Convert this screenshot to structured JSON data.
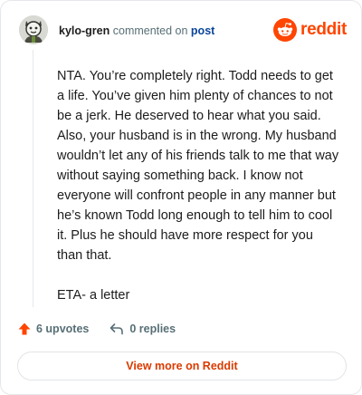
{
  "comment_header": {
    "username": "kylo-gren",
    "action_text": "commented on",
    "post_link": "post"
  },
  "brand": {
    "wordmark": "reddit",
    "logo_icon": "reddit-snoo-icon",
    "color": "#ff4500"
  },
  "comment": {
    "paragraphs": [
      "NTA. You’re completely right. Todd needs to get a life. You’ve given him plenty of chances to not be a jerk. He deserved to hear what you said. Also, your husband is in the wrong. My husband wouldn’t let any of his friends talk to me that way without saying something back. I know not everyone will confront people in any manner but he’s known Todd long enough to tell him to cool it. Plus he should have more respect for you than that.",
      "ETA- a letter"
    ]
  },
  "stats": {
    "upvotes": "6 upvotes",
    "replies": "0 replies",
    "upvote_icon": "upvote-arrow-icon",
    "reply_icon": "reply-arrow-icon"
  },
  "actions": {
    "view_more": "View more on Reddit"
  }
}
